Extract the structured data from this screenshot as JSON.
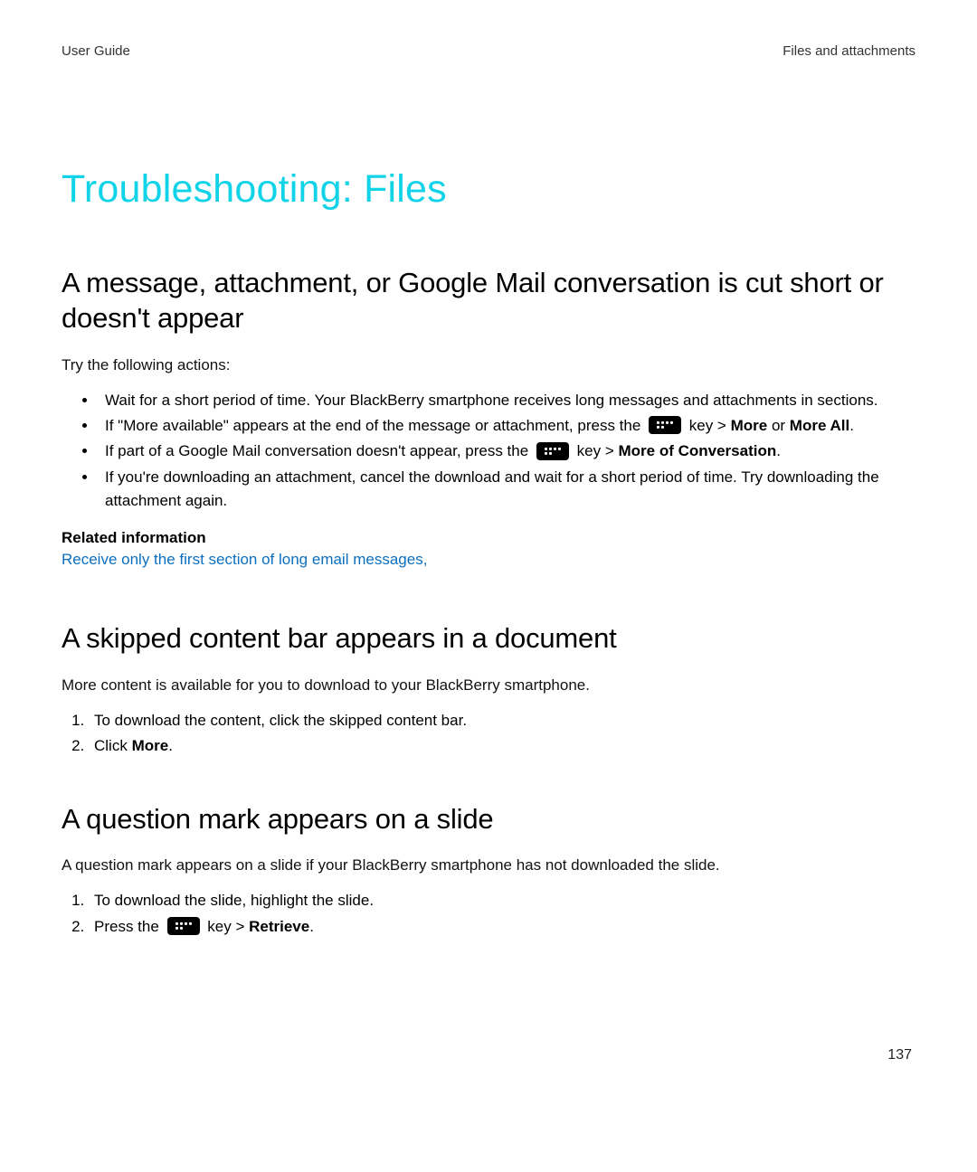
{
  "header": {
    "left": "User Guide",
    "right": "Files and attachments"
  },
  "title": "Troubleshooting: Files",
  "section1": {
    "heading": "A message, attachment, or Google Mail conversation is cut short or doesn't appear",
    "intro": "Try the following actions:",
    "bullet1": "Wait for a short period of time. Your BlackBerry smartphone receives long messages and attachments in sections.",
    "bullet2_a": "If \"More available\" appears at the end of the message or attachment, press the ",
    "bullet2_b": " key > ",
    "bullet2_more": "More",
    "bullet2_c": " or ",
    "bullet2_moreall": "More All",
    "bullet2_d": ".",
    "bullet3_a": "If part of a Google Mail conversation doesn't appear, press the ",
    "bullet3_b": " key > ",
    "bullet3_moc": "More of Conversation",
    "bullet3_c": ".",
    "bullet4": "If you're downloading an attachment, cancel the download and wait for a short period of time. Try downloading the attachment again.",
    "related_heading": "Related information",
    "related_link": "Receive only the first section of long email messages,"
  },
  "section2": {
    "heading": "A skipped content bar appears in a document",
    "intro": "More content is available for you to download to your BlackBerry smartphone.",
    "step1": "To download the content, click the skipped content bar.",
    "step2_a": "Click ",
    "step2_more": "More",
    "step2_b": "."
  },
  "section3": {
    "heading": "A question mark appears on a slide",
    "intro": "A question mark appears on a slide if your BlackBerry smartphone has not downloaded the slide.",
    "step1": "To download the slide, highlight the slide.",
    "step2_a": "Press the ",
    "step2_b": " key > ",
    "step2_retrieve": "Retrieve",
    "step2_c": "."
  },
  "page_number": "137"
}
